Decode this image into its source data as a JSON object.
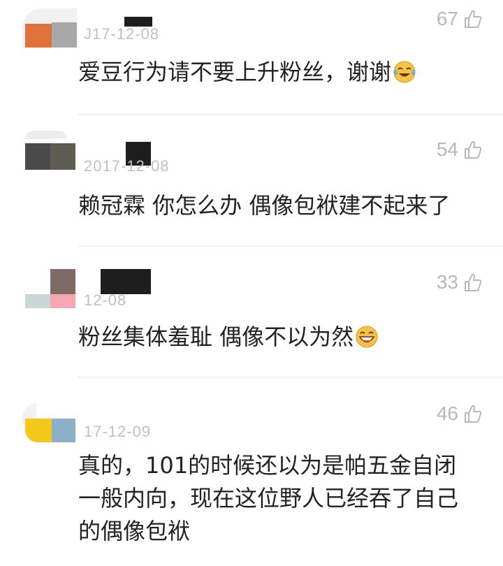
{
  "comments": [
    {
      "date": "J17-12-08",
      "likes": "67",
      "text": "爱豆行为请不要上升粉丝，谢谢",
      "emoji": "tears-of-joy-emoji"
    },
    {
      "date": "2017-12-08",
      "likes": "54",
      "text": "赖冠霖 你怎么办 偶像包袱建不起来了"
    },
    {
      "date": "12-08",
      "likes": "33",
      "text": "粉丝集体羞耻 偶像不以为然",
      "emoji": "grinning-emoji"
    },
    {
      "date": "17-12-09",
      "likes": "46",
      "text": "真的，101的时候还以为是帕五金自闭一般内向，现在这位野人已经吞了自己的偶像包袱"
    }
  ],
  "icons": {
    "like": "thumbs-up-icon"
  },
  "colors": {
    "text": "#222222",
    "meta": "#c0c0c0",
    "likes": "#b8b8b8",
    "divider": "#efefef"
  }
}
